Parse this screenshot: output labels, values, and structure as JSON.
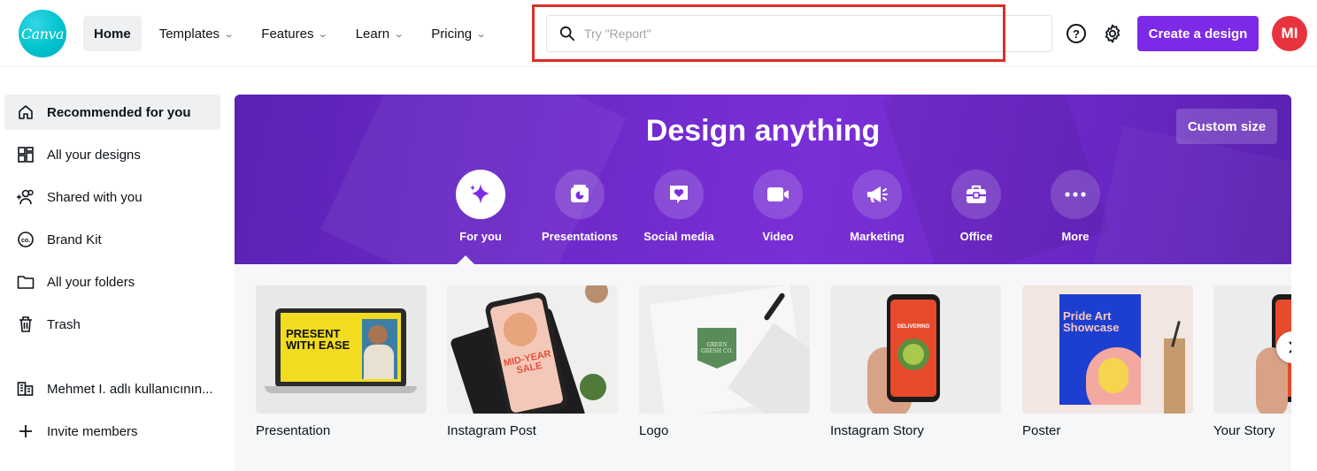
{
  "header": {
    "logo_text": "Canva",
    "nav": [
      {
        "label": "Home",
        "active": true,
        "dropdown": false
      },
      {
        "label": "Templates",
        "dropdown": true
      },
      {
        "label": "Features",
        "dropdown": true
      },
      {
        "label": "Learn",
        "dropdown": true
      },
      {
        "label": "Pricing",
        "dropdown": true
      }
    ],
    "search_placeholder": "Try \"Report\"",
    "help_glyph": "?",
    "create_label": "Create a design",
    "avatar_initials": "MI",
    "accent_color": "#7d2ae8",
    "avatar_color": "#e8333f"
  },
  "sidebar": {
    "items": [
      {
        "label": "Recommended for you",
        "icon": "home-icon",
        "active": true
      },
      {
        "label": "All your designs",
        "icon": "grid-icon"
      },
      {
        "label": "Shared with you",
        "icon": "shared-users-icon"
      },
      {
        "label": "Brand Kit",
        "icon": "brand-kit-icon"
      },
      {
        "label": "All your folders",
        "icon": "folder-icon"
      },
      {
        "label": "Trash",
        "icon": "trash-icon"
      },
      {
        "label": "Mehmet I. adlı kullanıcının...",
        "icon": "team-building-icon"
      },
      {
        "label": "Invite members",
        "icon": "plus-icon"
      }
    ]
  },
  "hero": {
    "title": "Design anything",
    "custom_size_label": "Custom size",
    "categories": [
      {
        "label": "For you",
        "icon": "sparkle-icon",
        "active": true
      },
      {
        "label": "Presentations",
        "icon": "presentation-icon"
      },
      {
        "label": "Social media",
        "icon": "heart-chat-icon"
      },
      {
        "label": "Video",
        "icon": "video-camera-icon"
      },
      {
        "label": "Marketing",
        "icon": "megaphone-icon"
      },
      {
        "label": "Office",
        "icon": "briefcase-icon"
      },
      {
        "label": "More",
        "icon": "more-dots-icon"
      }
    ]
  },
  "cards": [
    {
      "label": "Presentation",
      "thumb_text": "PRESENT WITH EASE"
    },
    {
      "label": "Instagram Post",
      "thumb_text": "MID-YEAR SALE"
    },
    {
      "label": "Logo",
      "thumb_text": "GREEN GRESH CO."
    },
    {
      "label": "Instagram Story",
      "thumb_text": "DELIVERING"
    },
    {
      "label": "Poster",
      "thumb_text": "Pride Art Showcase"
    },
    {
      "label": "Your Story",
      "thumb_text": ""
    }
  ]
}
